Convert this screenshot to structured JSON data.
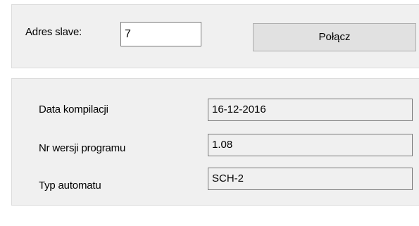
{
  "connection": {
    "slave_label": "Adres slave:",
    "slave_value": "7",
    "connect_label": "Połącz"
  },
  "info": {
    "rows": [
      {
        "label": "Data kompilacji",
        "value": "16-12-2016"
      },
      {
        "label": "Nr wersji programu",
        "value": "1.08"
      },
      {
        "label": "Typ automatu",
        "value": "SCH-2"
      }
    ]
  }
}
